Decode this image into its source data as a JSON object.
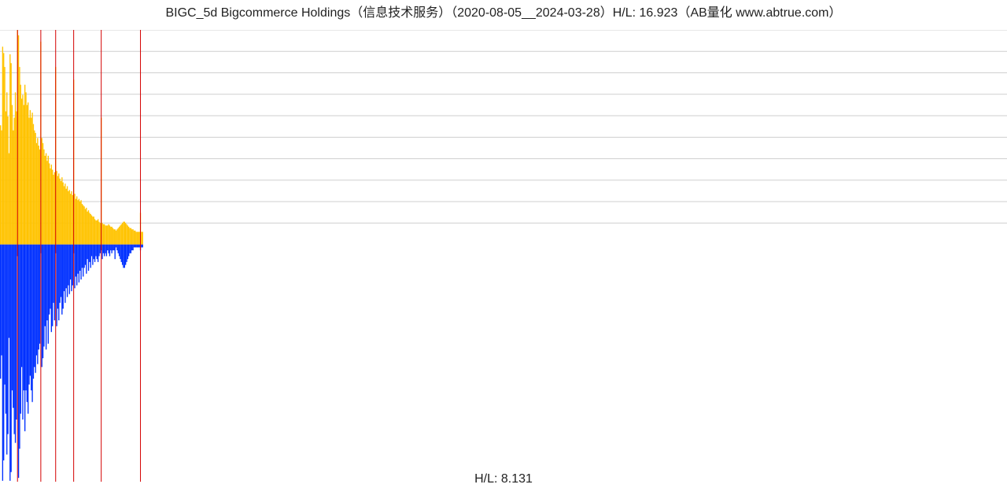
{
  "title": "BIGC_5d Bigcommerce Holdings（信息技术服务）（2020-08-05__2024-03-28）H/L: 16.923（AB量化  www.abtrue.com）",
  "footer": "H/L: 8.131",
  "chart_data": {
    "type": "bar",
    "title": "BIGC_5d Bigcommerce Holdings（信息技术服务）（2020-08-05__2024-03-28）H/L: 16.923（AB量化  www.abtrue.com）",
    "notes": "Upper panel = High (yellow bars), lower panel = Low (blue bars downward). Red vertical marker lines at bars 16,38,52,69,95,132. Data occupies roughly first 14% of x-range; rest of timeline is empty.",
    "hl_ratio_top": 16.923,
    "hl_ratio_bottom": 8.131,
    "upper_ylim": [
      0,
      16.923
    ],
    "lower_ylim": [
      0,
      8.131
    ],
    "grid_lines_upper": 10,
    "x_slots": 950,
    "markers": [
      16,
      38,
      52,
      69,
      95,
      132
    ],
    "series": [
      {
        "name": "High",
        "color": "#FFC300",
        "values": [
          9.4,
          9.0,
          15.6,
          15.1,
          14.0,
          10.5,
          12.0,
          10.1,
          7.2,
          15.0,
          14.3,
          11.0,
          9.0,
          10.0,
          12.0,
          10.5,
          16.9,
          16.5,
          14.0,
          12.6,
          11.5,
          11.8,
          11.0,
          12.6,
          12.0,
          11.0,
          11.2,
          10.0,
          10.6,
          10.0,
          10.4,
          9.5,
          9.0,
          8.8,
          8.0,
          8.4,
          7.8,
          7.5,
          16.0,
          8.4,
          8.0,
          7.5,
          7.0,
          7.2,
          6.6,
          7.0,
          6.4,
          6.0,
          6.3,
          5.9,
          5.5,
          5.7,
          14.0,
          5.8,
          5.4,
          5.6,
          5.2,
          5.0,
          5.3,
          4.9,
          4.6,
          4.8,
          4.4,
          4.6,
          4.2,
          4.3,
          4.0,
          4.2,
          3.9,
          13.0,
          4.0,
          3.6,
          3.8,
          3.5,
          3.6,
          3.4,
          3.5,
          3.2,
          3.1,
          3.0,
          2.8,
          2.9,
          2.6,
          2.7,
          2.5,
          2.4,
          2.3,
          2.2,
          2.2,
          2.0,
          1.9,
          1.9,
          2.0,
          1.8,
          1.7,
          10.0,
          1.7,
          1.6,
          1.6,
          1.5,
          1.5,
          1.5,
          1.6,
          1.5,
          1.4,
          1.4,
          1.3,
          1.2,
          1.2,
          1.1,
          1.2,
          1.3,
          1.4,
          1.5,
          1.6,
          1.7,
          1.8,
          1.8,
          1.7,
          1.6,
          1.5,
          1.4,
          1.3,
          1.3,
          1.2,
          1.2,
          1.1,
          1.1,
          1.0,
          1.0,
          1.0,
          1.0,
          2.5,
          1.0,
          1.0
        ]
      },
      {
        "name": "Low",
        "color": "#0030FF",
        "values": [
          4.6,
          3.8,
          8.1,
          7.4,
          4.8,
          5.8,
          7.2,
          6.5,
          3.2,
          8.1,
          7.8,
          5.0,
          5.6,
          6.5,
          6.8,
          6.0,
          0.4,
          8.0,
          7.0,
          5.8,
          4.2,
          6.0,
          5.0,
          6.4,
          5.0,
          5.4,
          5.8,
          4.8,
          4.5,
          5.0,
          5.4,
          4.6,
          4.2,
          4.4,
          3.8,
          4.1,
          3.6,
          3.4,
          0.3,
          4.2,
          3.9,
          3.5,
          2.8,
          3.6,
          2.6,
          3.4,
          2.4,
          2.2,
          3.0,
          2.8,
          2.0,
          2.6,
          0.3,
          2.8,
          2.2,
          2.6,
          2.0,
          1.8,
          2.4,
          2.2,
          1.6,
          2.0,
          1.5,
          1.8,
          1.4,
          1.7,
          1.2,
          1.6,
          1.4,
          0.3,
          1.5,
          1.1,
          1.4,
          1.0,
          1.3,
          0.9,
          1.2,
          0.8,
          1.1,
          0.8,
          0.7,
          1.0,
          0.5,
          0.9,
          0.6,
          0.8,
          0.4,
          0.7,
          0.5,
          0.6,
          0.4,
          0.5,
          0.6,
          0.4,
          0.3,
          0.2,
          0.5,
          0.3,
          0.4,
          0.3,
          0.4,
          0.2,
          0.3,
          0.4,
          0.2,
          0.3,
          0.2,
          0.2,
          0.5,
          0.1,
          0.2,
          0.3,
          0.4,
          0.5,
          0.6,
          0.7,
          0.8,
          0.8,
          0.7,
          0.6,
          0.5,
          0.4,
          0.3,
          0.3,
          0.2,
          0.2,
          0.1,
          0.1,
          0.1,
          0.1,
          0.1,
          0.1,
          0.2,
          0.1,
          0.1
        ]
      }
    ]
  }
}
